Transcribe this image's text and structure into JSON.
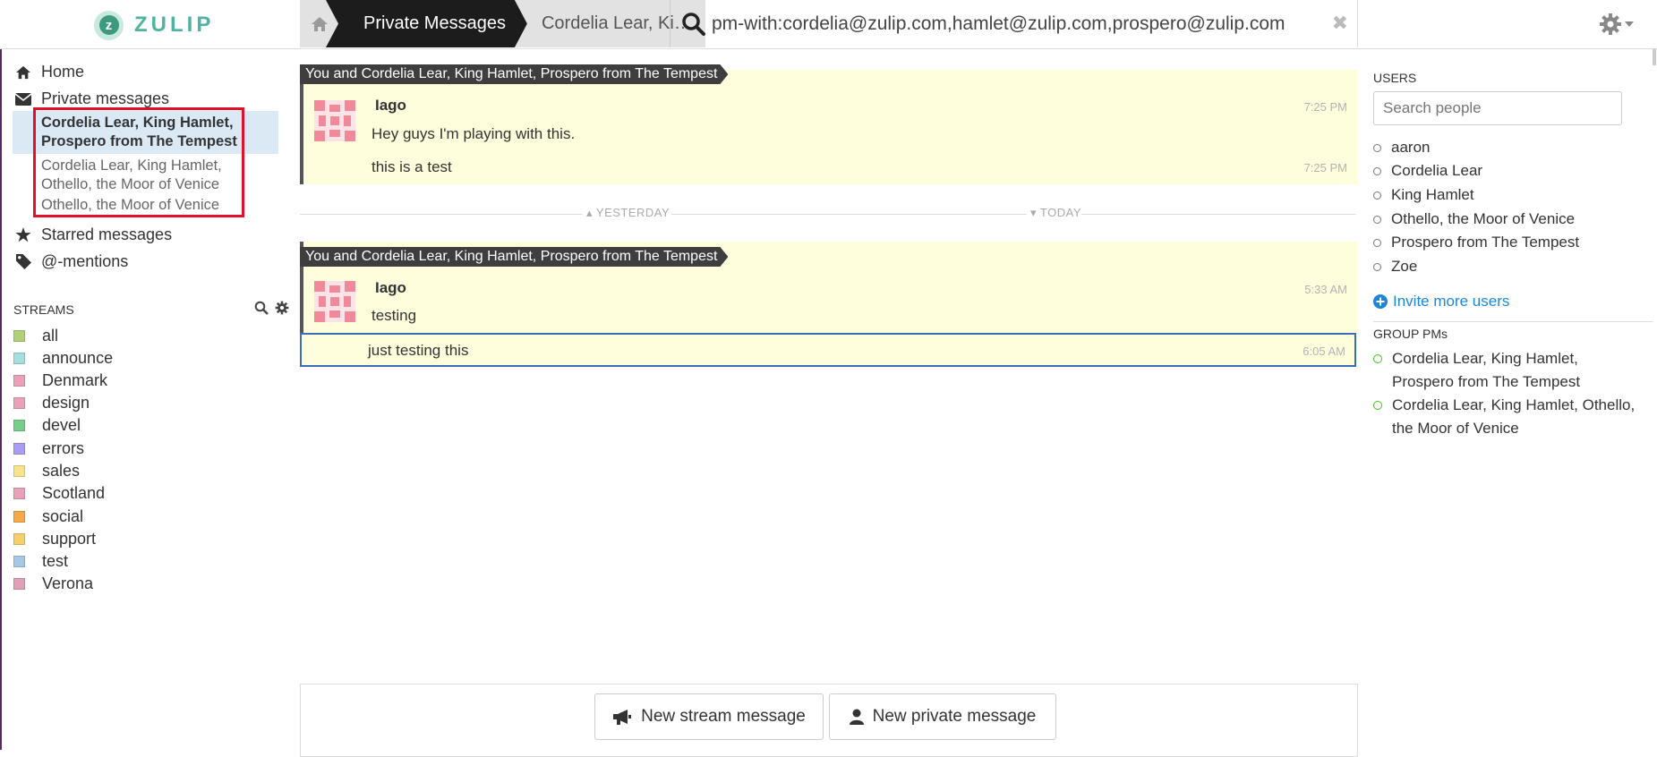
{
  "brand": {
    "name": "ZULIP",
    "logo_letter": "z"
  },
  "breadcrumbs": {
    "section": "Private Messages",
    "recipients": "Cordelia Lear, Ki…"
  },
  "search": {
    "query": "pm-with:cordelia@zulip.com,hamlet@zulip.com,prospero@zulip.com"
  },
  "nav": {
    "home": "Home",
    "private": "Private messages",
    "pm_conversations": [
      {
        "line1": "Cordelia Lear, King Hamlet,",
        "line2": "Prospero from The Tempest",
        "active": true
      },
      {
        "line1": "Cordelia Lear, King Hamlet,",
        "line2": "Othello, the Moor of Venice",
        "active": false
      },
      {
        "line1": "Othello, the Moor of Venice",
        "line2": "",
        "active": false
      }
    ],
    "starred": "Starred messages",
    "mentions": "@-mentions"
  },
  "streams": {
    "header": "STREAMS",
    "items": [
      {
        "name": "all",
        "color": "#b0d07a"
      },
      {
        "name": "announce",
        "color": "#a6dde0"
      },
      {
        "name": "Denmark",
        "color": "#e9a1ba"
      },
      {
        "name": "design",
        "color": "#e9a1ba"
      },
      {
        "name": "devel",
        "color": "#76ce8a"
      },
      {
        "name": "errors",
        "color": "#a99cf5"
      },
      {
        "name": "sales",
        "color": "#f7e38a"
      },
      {
        "name": "Scotland",
        "color": "#e9a1ba"
      },
      {
        "name": "social",
        "color": "#f4a94a"
      },
      {
        "name": "support",
        "color": "#f5cf6e"
      },
      {
        "name": "test",
        "color": "#a6c7e5"
      },
      {
        "name": "Verona",
        "color": "#e29fb8"
      }
    ]
  },
  "messages": {
    "group1": {
      "recipient_bar": "You and Cordelia Lear, King Hamlet, Prospero from The Tempest",
      "sender": "Iago",
      "rows": [
        {
          "text": "Hey guys I'm playing with this.",
          "time": "7:25 PM"
        },
        {
          "text": "this is a test",
          "time": "7:25 PM"
        }
      ]
    },
    "date_sep": {
      "left": "YESTERDAY",
      "right": "TODAY"
    },
    "group2": {
      "recipient_bar": "You and Cordelia Lear, King Hamlet, Prospero from The Tempest",
      "sender": "Iago",
      "rows": [
        {
          "text": "testing",
          "time": "5:33 AM"
        },
        {
          "text": "just testing this",
          "time": "6:05 AM"
        }
      ]
    }
  },
  "compose": {
    "stream_btn": "New stream message",
    "private_btn": "New private message"
  },
  "right": {
    "users_header": "USERS",
    "search_placeholder": "Search people",
    "users": [
      "aaron",
      "Cordelia Lear",
      "King Hamlet",
      "Othello, the Moor of Venice",
      "Prospero from The Tempest",
      "Zoe"
    ],
    "invite": "Invite more users",
    "group_header": "GROUP PMs",
    "group_pms": [
      {
        "line1": "Cordelia Lear, King Hamlet,",
        "line2": "Prospero from The Tempest"
      },
      {
        "line1": "Cordelia Lear, King Hamlet, Othello,",
        "line2": "the Moor of Venice"
      }
    ]
  }
}
